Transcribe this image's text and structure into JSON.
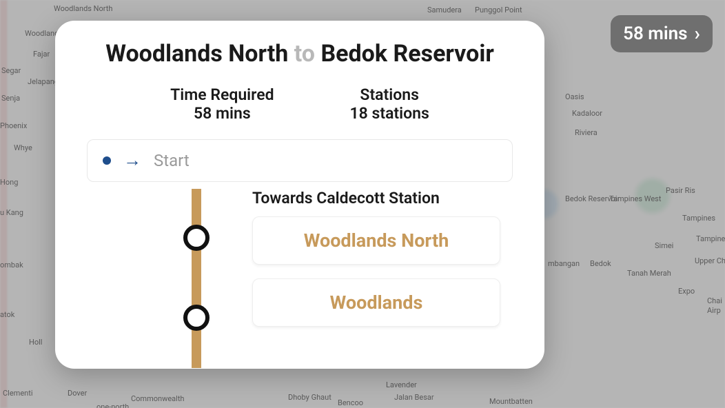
{
  "badge": {
    "time": "58 mins"
  },
  "title": {
    "from": "Woodlands North",
    "connector": "to",
    "to": "Bedok Reservoir"
  },
  "stats": {
    "time_label": "Time Required",
    "time_value": "58 mins",
    "stations_label": "Stations",
    "stations_value": "18 stations"
  },
  "start": {
    "label": "Start"
  },
  "route": {
    "towards": "Towards Caldecott Station",
    "stations": [
      "Woodlands North",
      "Woodlands"
    ],
    "line_color": "#c79a5b"
  },
  "map_labels": {
    "l0": "Woodlands North",
    "l1": "Woodlands",
    "l2": "Samudera",
    "l3": "Punggol Point",
    "l4": "Fajar",
    "l5": "Segar",
    "l6": "Jelapang",
    "l7": "Senja",
    "l8": "Phoenix",
    "l9": "Whye",
    "l10": "Hong",
    "l11": "u Kang",
    "l12": "ombak",
    "l13": "atok",
    "l14": "Holl",
    "l15": "Clementi",
    "l16": "Dover",
    "l17": "Commonwealth",
    "l18": "one-north",
    "l19": "Dhoby Ghaut",
    "l20": "Bencoo",
    "l21": "Lavender",
    "l22": "Jalan Besar",
    "l23": "Mountbatten",
    "l24": "Oasis",
    "l25": "Kadaloor",
    "l26": "Riviera",
    "l27": "Pasir Ris",
    "l28": "Tampines",
    "l29": "Tampines West",
    "l30": "Bedok Reservoir",
    "l31": "Simei",
    "l32": "Bedok",
    "l33": "Tanah Merah",
    "l34": "Expo",
    "l35": "Upper Ch",
    "l36": "mbangan",
    "l37": "Tampine",
    "l38": "Chai",
    "l39": "Airp"
  }
}
